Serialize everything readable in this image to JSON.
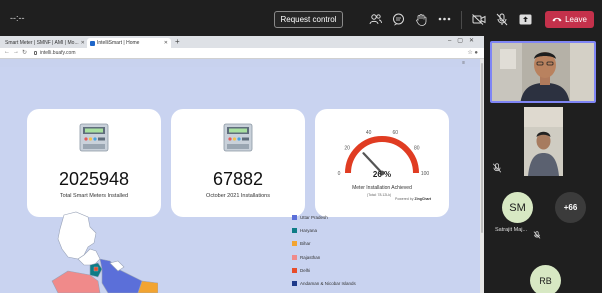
{
  "meeting": {
    "timer": "--:--",
    "request_control_label": "Request control",
    "leave_label": "Leave"
  },
  "toolbar_icons": [
    "people-icon",
    "chat-icon",
    "react-icon",
    "more-icon",
    "camera-off-icon",
    "mic-off-icon",
    "share-icon",
    "phone-icon"
  ],
  "browser": {
    "tabs": [
      {
        "title": "Smart Meter | SMNF | AMI | Mo...",
        "active": false
      },
      {
        "title": "IntelliSmart | Home",
        "active": true
      }
    ],
    "url": "intelli.buafy.com"
  },
  "dashboard": {
    "cards": [
      {
        "value": "2025948",
        "caption": "Total Smart Meters Installed"
      },
      {
        "value": "67882",
        "caption": "October 2021 Installations"
      }
    ],
    "gauge": {
      "percent_label": "26 %",
      "value": 26,
      "title": "Meter Installation Achieved",
      "subtitle": "(Total: 78.12Lk)",
      "credit_prefix": "Powered by",
      "credit_brand": "ZingChart",
      "ticks": [
        "0",
        "20",
        "40",
        "60",
        "80",
        "100"
      ],
      "colors": {
        "track": "#e03c22",
        "needle": "#555555"
      }
    },
    "legend": [
      {
        "label": "Uttar Pradesh",
        "color": "#5b6fd9"
      },
      {
        "label": "Haryana",
        "color": "#0e7c86"
      },
      {
        "label": "Bihar",
        "color": "#f2a431"
      },
      {
        "label": "Rajasthan",
        "color": "#f08a8a"
      },
      {
        "label": "Delhi",
        "color": "#e84d2a"
      },
      {
        "label": "Andaman & Nicobar Islands",
        "color": "#1e3a8a"
      }
    ]
  },
  "participants": {
    "sm": {
      "initials": "SM",
      "name": "Satrajit Maj..."
    },
    "more_count": "+66",
    "rb": {
      "initials": "RB"
    }
  },
  "colors": {
    "leave": "#c4314b",
    "active_speaker": "#7f85f5",
    "avatar_bg": "#d7e8c3"
  }
}
